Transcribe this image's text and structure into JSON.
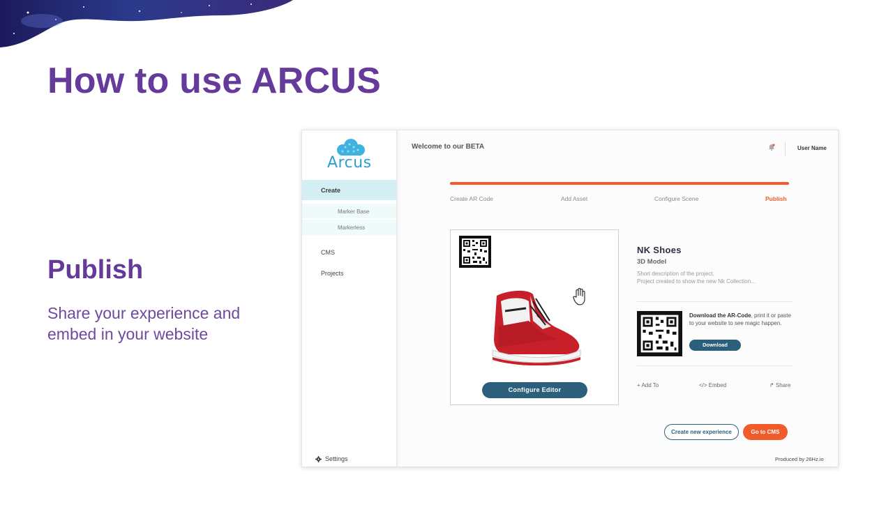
{
  "slide": {
    "title": "How to use ARCUS",
    "section_title": "Publish",
    "section_desc": "Share your experience and embed in your website"
  },
  "app": {
    "logo_text": "Arcus",
    "sidebar": {
      "create": "Create",
      "sub_items": [
        "Marker Base",
        "Markerless"
      ],
      "cms": "CMS",
      "projects": "Projects",
      "settings": "Settings"
    },
    "topbar": {
      "welcome": "Welcome to our BETA",
      "username": "User Name"
    },
    "steps": [
      "Create AR Code",
      "Add Asset",
      "Configure Scene",
      "Publish"
    ],
    "active_step": "Publish",
    "preview": {
      "configure_label": "Configure Editor"
    },
    "project": {
      "name": "NK Shoes",
      "type": "3D Model",
      "desc_line1": "Short description of the project.",
      "desc_line2": "Project created to show the new Nk Collection...",
      "download_title": "Download the AR-Code",
      "download_text": ", print it or paste to your website to see magic happen.",
      "download_label": "Download",
      "actions": [
        "+ Add To",
        "</> Embed",
        "↱ Share"
      ]
    },
    "footer": {
      "create_new": "Create new experience",
      "go_cms": "Go to CMS",
      "produced": "Produced by 26Hz.io"
    },
    "colors": {
      "accent": "#f15a2b",
      "primary": "#2c5f7c",
      "title_purple": "#663a9a",
      "sidebar_active": "#d3eff3"
    }
  }
}
